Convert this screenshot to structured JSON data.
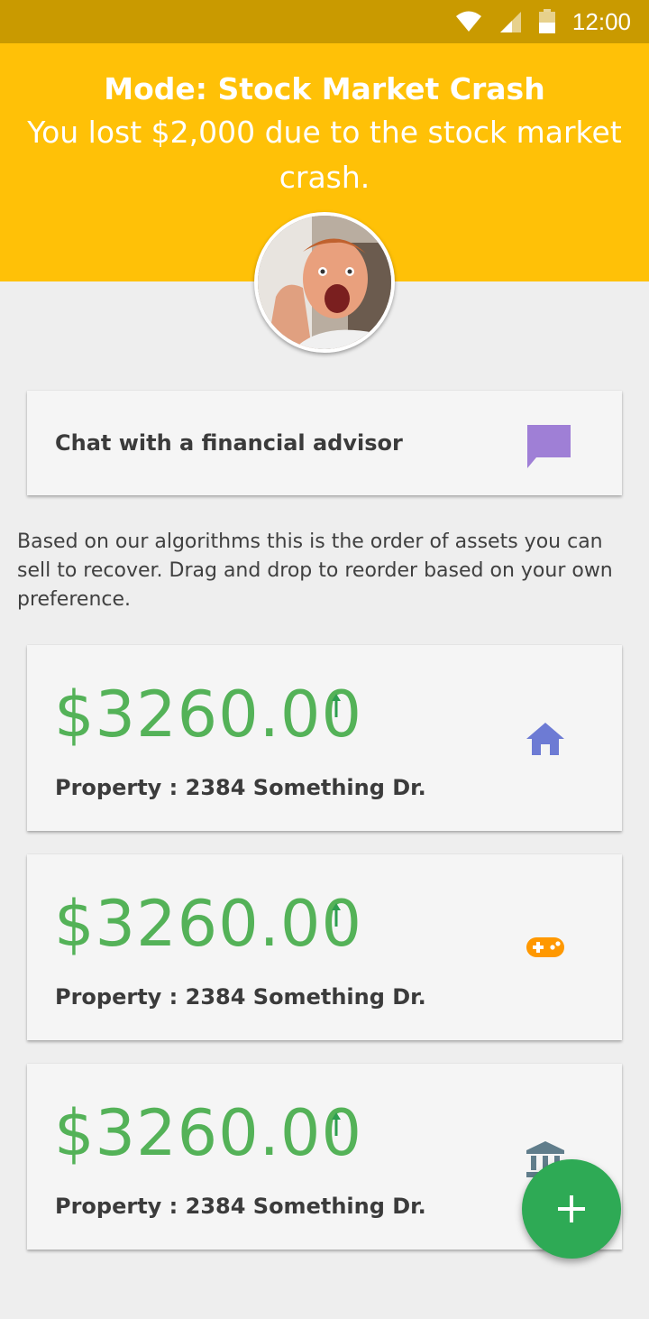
{
  "status_bar": {
    "time": "12:00"
  },
  "header": {
    "mode_title": "Mode: Stock Market Crash",
    "subtitle": "You lost $2,000 due to the stock market crash."
  },
  "chat": {
    "label": "Chat with a financial advisor",
    "icon": "chat-bubble-icon"
  },
  "description": "Based on our algorithms this is the order of assets you can sell to recover. Drag and drop to reorder based on your own preference.",
  "assets": [
    {
      "amount": "$3260.00",
      "label": "Property : 2384 Something Dr.",
      "icon": "home-icon",
      "icon_color": "#6d7bd4"
    },
    {
      "amount": "$3260.00",
      "label": "Property : 2384 Something Dr.",
      "icon": "gamepad-icon",
      "icon_color": "#ff9800"
    },
    {
      "amount": "$3260.00",
      "label": "Property : 2384 Something Dr.",
      "icon": "bank-icon",
      "icon_color": "#607d8b"
    }
  ],
  "colors": {
    "header": "#ffc107",
    "status_bar": "#c99a00",
    "amount": "#4caf50",
    "fab": "#2eaa55",
    "chat_icon": "#9f7fd6"
  }
}
